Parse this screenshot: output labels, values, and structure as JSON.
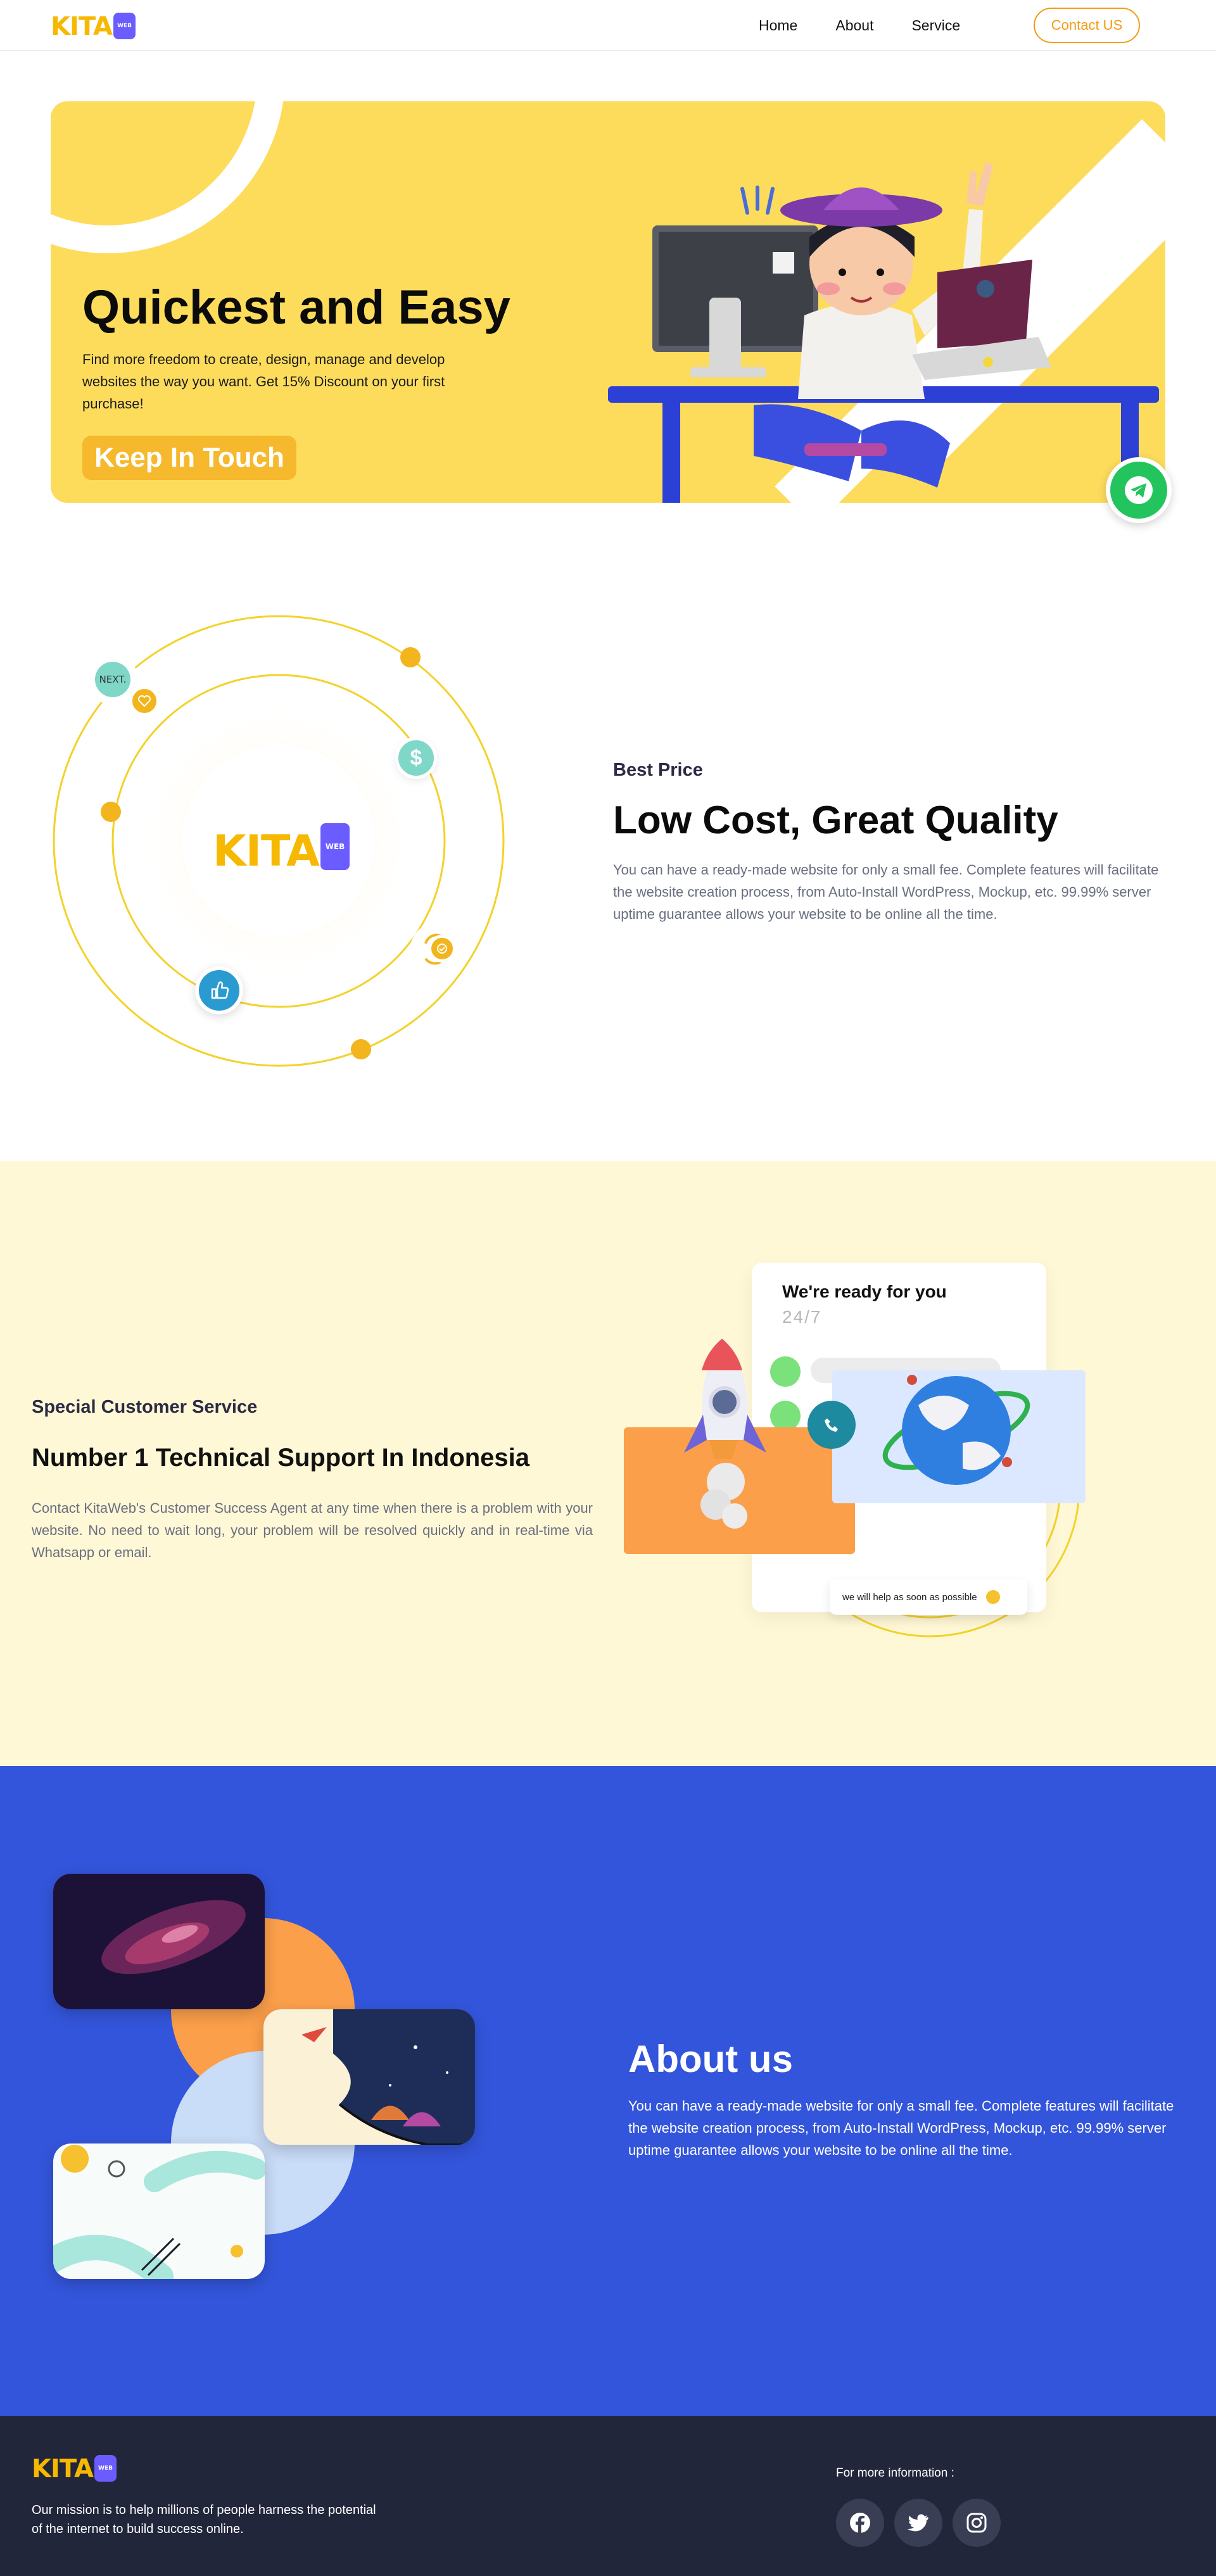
{
  "brand": {
    "name": "KITA",
    "tag": "WEB",
    "color": "#f6b800",
    "badge_color": "#6a5cff"
  },
  "nav": {
    "links": [
      "Home",
      "About",
      "Service"
    ],
    "cta": "Contact US"
  },
  "hero": {
    "title": "Quickest and Easy",
    "text": "Find more freedom to create, design, manage and develop websites the way you want. Get 15% Discount on your first purchase!",
    "button": "Keep In Touch",
    "bg_color": "#fddc5c"
  },
  "features": {
    "eyebrow": "Best Price",
    "title": "Low Cost, Great Quality",
    "text": "You can have a ready-made website for only a small fee. Complete features will facilitate the website creation process, from Auto-Install WordPress, Mockup, etc. 99.99% server uptime guarantee allows your website to be online all the time.",
    "orbit_badge": "NEXT."
  },
  "support": {
    "eyebrow": "Special Customer Service",
    "title": "Number 1 Technical Support In Indonesia",
    "text": "Contact KitaWeb's Customer Success Agent at any time when there is a problem with your website. No need to wait long, your problem will be resolved quickly and in real-time via Whatsapp or email.",
    "card_title": "We're ready for you",
    "card_sub": "24/7",
    "chat_text": "we will help as soon as possible",
    "bg_color": "#fff8d6"
  },
  "about": {
    "title": "About us",
    "text": "You can have a ready-made website for only a small fee. Complete features will facilitate the website creation process, from Auto-Install WordPress, Mockup, etc. 99.99% server uptime guarantee allows your website to be online all the time.",
    "bg_color": "#3355db"
  },
  "footer": {
    "mission": "Our mission is to help millions of people harness the potential of the internet to build success online.",
    "info_label": "For more information :",
    "socials": [
      "facebook-icon",
      "twitter-icon",
      "instagram-icon"
    ],
    "bg_color": "#22263b"
  }
}
